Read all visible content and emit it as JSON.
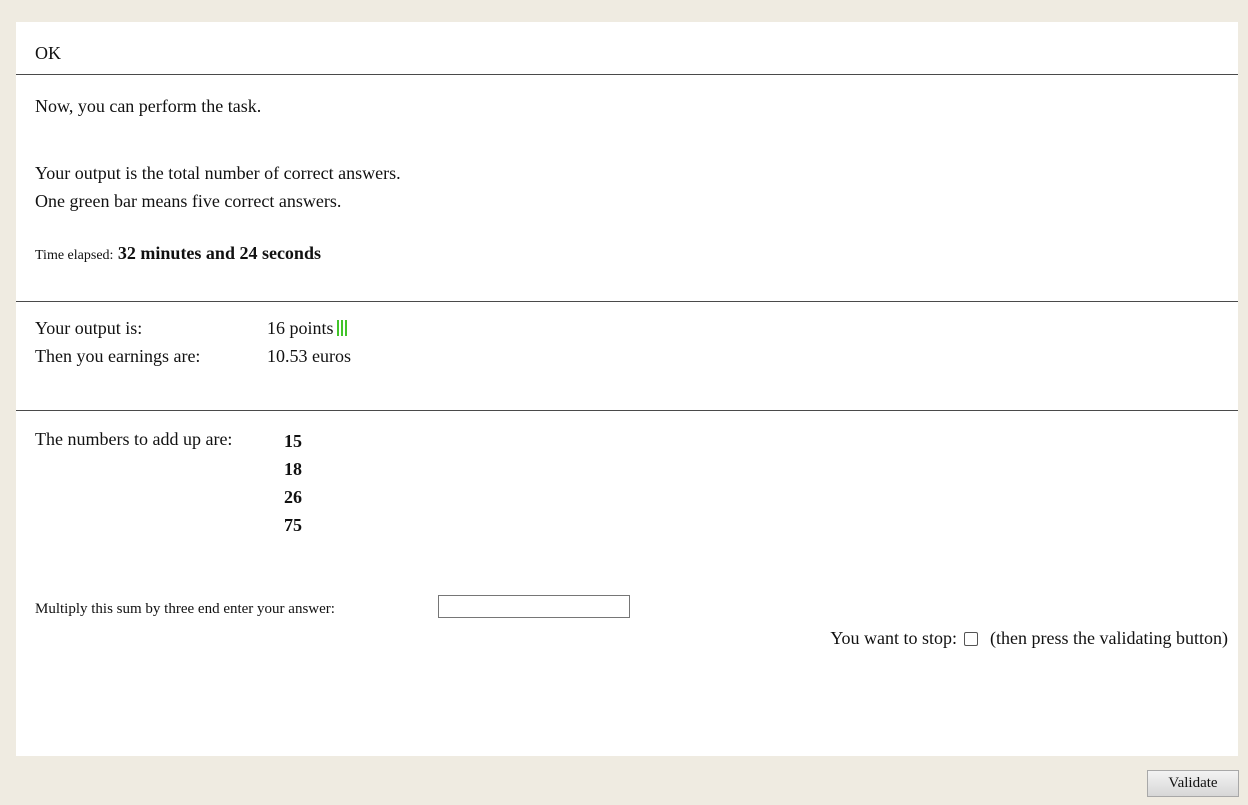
{
  "status": "OK",
  "intro": "Now, you can perform the task.",
  "info": {
    "line1": "Your output is the total number of correct answers.",
    "line2": "One green bar means five correct answers."
  },
  "timer": {
    "label": "Time elapsed:",
    "value": "32 minutes and 24 seconds"
  },
  "summary": {
    "output_label": "Your output is:",
    "output_value": "16 points",
    "green_bars": 3,
    "bar_color": "#42c42a",
    "earnings_label": "Then you earnings are:",
    "earnings_value": "10.53 euros"
  },
  "task": {
    "label": "The numbers to add up are:",
    "numbers": [
      "15",
      "18",
      "26",
      "75"
    ],
    "prompt": "Multiply this sum by three end enter your answer:",
    "answer_value": ""
  },
  "stop": {
    "label": "You want to stop:",
    "note": "(then press the validating button)"
  },
  "validate_label": "Validate",
  "colors": {
    "page_background": "#efebe1",
    "panel_background": "#ffffff"
  }
}
